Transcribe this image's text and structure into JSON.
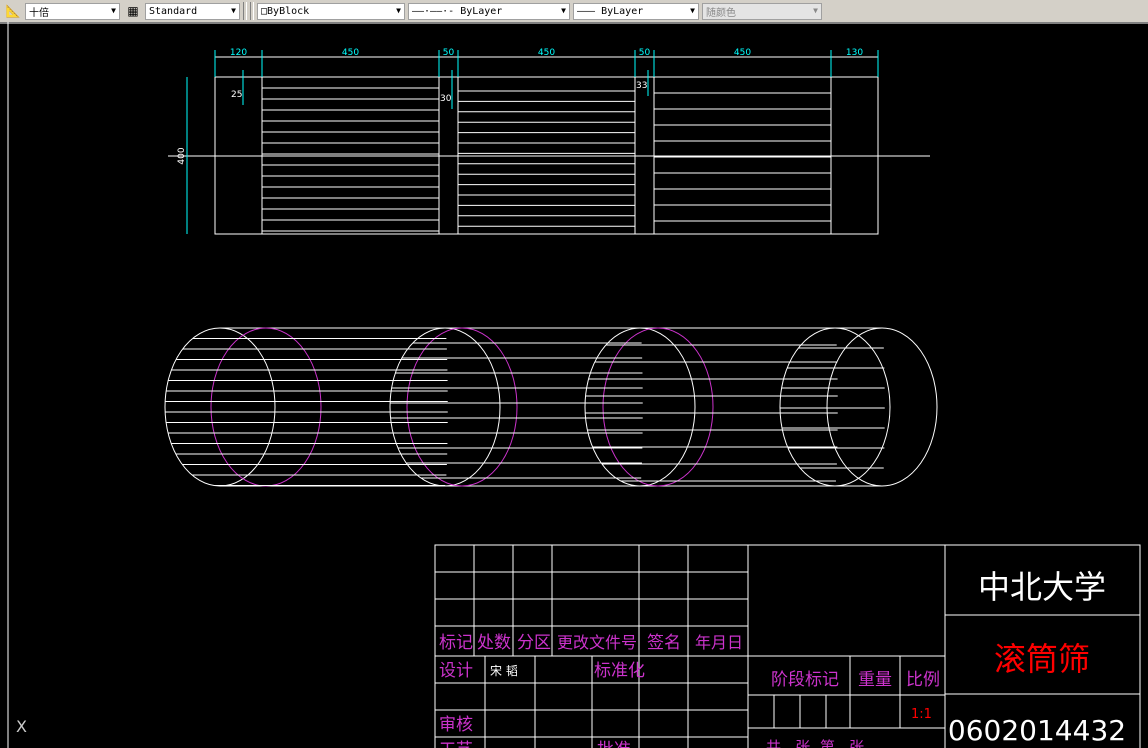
{
  "toolbar": {
    "dimscale": "十倍",
    "textstyle": "Standard",
    "color": "ByBlock",
    "linetype": "ByLayer",
    "lineweight": "ByLayer",
    "plotstyle": "随颜色",
    "linetype_sample": "——·——·-",
    "lineweight_sample": "———"
  },
  "dimensions": {
    "top": [
      "120",
      "450",
      "50",
      "450",
      "50",
      "450",
      "130"
    ],
    "side": [
      "25",
      "30",
      "33"
    ],
    "height": "400"
  },
  "title_block": {
    "headers": [
      "标记",
      "处数",
      "分区",
      "更改文件号",
      "签名",
      "年月日"
    ],
    "design": "设计",
    "designer": "宋 韬",
    "standardization": "标准化",
    "review": "审核",
    "process": "工艺",
    "approve": "批准",
    "stage_mark": "阶段标记",
    "weight": "重量",
    "scale_label": "比例",
    "scale": "1:1",
    "sheets": "共   张  第   张",
    "school": "中北大学",
    "drawing_name": "滚筒筛",
    "drawing_number": "0602014432"
  },
  "colors": {
    "cyan": "#00ffff",
    "magenta": "#cc33cc",
    "red": "#ff0000",
    "white": "#ffffff"
  },
  "ucs_icon": "X"
}
